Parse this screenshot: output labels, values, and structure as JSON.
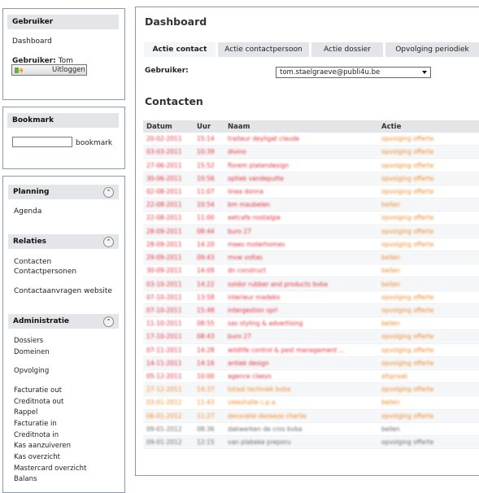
{
  "user_box": {
    "title": "Gebruiker",
    "dashboard_link": "Dashboard",
    "user_label": "Gebruiker:",
    "user_name": "Tom",
    "logout_button": "Uitloggen"
  },
  "bookmark_box": {
    "title": "Bookmark",
    "input_value": "",
    "link": "bookmark"
  },
  "planning": {
    "title": "Planning",
    "items": [
      "Agenda"
    ]
  },
  "relaties": {
    "title": "Relaties",
    "items": [
      "Contacten",
      "Contactpersonen",
      "Contactaanvragen website"
    ]
  },
  "administratie": {
    "title": "Administratie",
    "items": [
      "Dossiers",
      "Domeinen",
      "Opvolging",
      "Facturatie out",
      "Creditnota out",
      "Rappel",
      "Facturatie in",
      "Creditnota in",
      "Kas aanzuiveren",
      "Kas overzicht",
      "Mastercard overzicht",
      "Balans"
    ]
  },
  "main": {
    "title": "Dashboard",
    "tabs": [
      "Actie contact",
      "Actie contactpersoon",
      "Actie dossier",
      "Opvolging periodiek"
    ],
    "user_filter_label": "Gebruiker:",
    "user_filter_value": "tom.staelgraeve@publi4u.be",
    "section_title": "Contacten"
  },
  "colors": {
    "red": "#e2303a",
    "orange": "#f08a2a",
    "gray": "#6b6b6b",
    "border": "#8a9aae",
    "header_bg": "#e3e5e8"
  },
  "contacts_table": {
    "headers": [
      "Datum",
      "Uur",
      "Naam",
      "Actie"
    ],
    "rows": [
      {
        "datum": "20-02-2011",
        "uur": "15:14",
        "naam": "traiteur deyligat claude",
        "actie": "opvolging offerte",
        "color": "red"
      },
      {
        "datum": "03-03-2011",
        "uur": "10:39",
        "naam": "divino",
        "actie": "opvolging offerte",
        "color": "red"
      },
      {
        "datum": "27-06-2011",
        "uur": "15:52",
        "naam": "florem platendesign",
        "actie": "opvolging offerte",
        "color": "red"
      },
      {
        "datum": "30-06-2011",
        "uur": "10:56",
        "naam": "optiek vandeputte",
        "actie": "opvolging offerte",
        "color": "red"
      },
      {
        "datum": "02-08-2011",
        "uur": "11:07",
        "naam": "linea donna",
        "actie": "opvolging offerte",
        "color": "red"
      },
      {
        "datum": "22-08-2011",
        "uur": "10:54",
        "naam": "bm maubelen",
        "actie": "bellen",
        "color": "red"
      },
      {
        "datum": "22-08-2011",
        "uur": "11:00",
        "naam": "eetcafe nostalgie",
        "actie": "opvolging offerte",
        "color": "red"
      },
      {
        "datum": "28-09-2011",
        "uur": "08:44",
        "naam": "buro 27",
        "actie": "opvolging offerte",
        "color": "red"
      },
      {
        "datum": "28-09-2011",
        "uur": "14:20",
        "naam": "maes moterhomes",
        "actie": "opvolging offerte",
        "color": "red"
      },
      {
        "datum": "29-09-2011",
        "uur": "09:43",
        "naam": "mvw voltas",
        "actie": "bellen",
        "color": "red"
      },
      {
        "datum": "30-09-2011",
        "uur": "14:09",
        "naam": "dn construct",
        "actie": "bellen",
        "color": "red"
      },
      {
        "datum": "03-10-2011",
        "uur": "14:22",
        "naam": "soldor rubber and products bvba",
        "actie": "bellen",
        "color": "red"
      },
      {
        "datum": "07-10-2011",
        "uur": "13:58",
        "naam": "interieur madeko",
        "actie": "opvolging offerte",
        "color": "red"
      },
      {
        "datum": "07-10-2011",
        "uur": "15:48",
        "naam": "intergestion sprl",
        "actie": "opvolging offerte",
        "color": "red"
      },
      {
        "datum": "11-10-2011",
        "uur": "08:55",
        "naam": "sas styling & advertising",
        "actie": "bellen",
        "color": "red"
      },
      {
        "datum": "17-10-2011",
        "uur": "08:43",
        "naam": "buro 27",
        "actie": "opvolging offerte",
        "color": "red"
      },
      {
        "datum": "07-11-2011",
        "uur": "14:28",
        "naam": "wildlife control & pest management ...",
        "actie": "opvolging offerte",
        "color": "red"
      },
      {
        "datum": "14-11-2011",
        "uur": "14:16",
        "naam": "antiek design",
        "actie": "opvolging offerte",
        "color": "red"
      },
      {
        "datum": "05-12-2011",
        "uur": "10:00",
        "naam": "agence claeys",
        "actie": "afspraak",
        "color": "red"
      },
      {
        "datum": "27-12-2011",
        "uur": "14:37",
        "naam": "totaal techniek bvba",
        "actie": "opvolging offerte",
        "color": "orange"
      },
      {
        "datum": "03-01-2012",
        "uur": "11:43",
        "naam": "vleeshalle c.p.a.",
        "actie": "bellen",
        "color": "orange"
      },
      {
        "datum": "06-01-2012",
        "uur": "11:27",
        "naam": "decoratie dezeeze charlie",
        "actie": "opvolging offerte",
        "color": "orange"
      },
      {
        "datum": "09-01-2012",
        "uur": "08:36",
        "naam": "dakwerken de cros bvba",
        "actie": "bellen",
        "color": "gray"
      },
      {
        "datum": "09-01-2012",
        "uur": "12:15",
        "naam": "van plabeke preporu",
        "actie": "opvolging offerte",
        "color": "gray"
      }
    ]
  }
}
